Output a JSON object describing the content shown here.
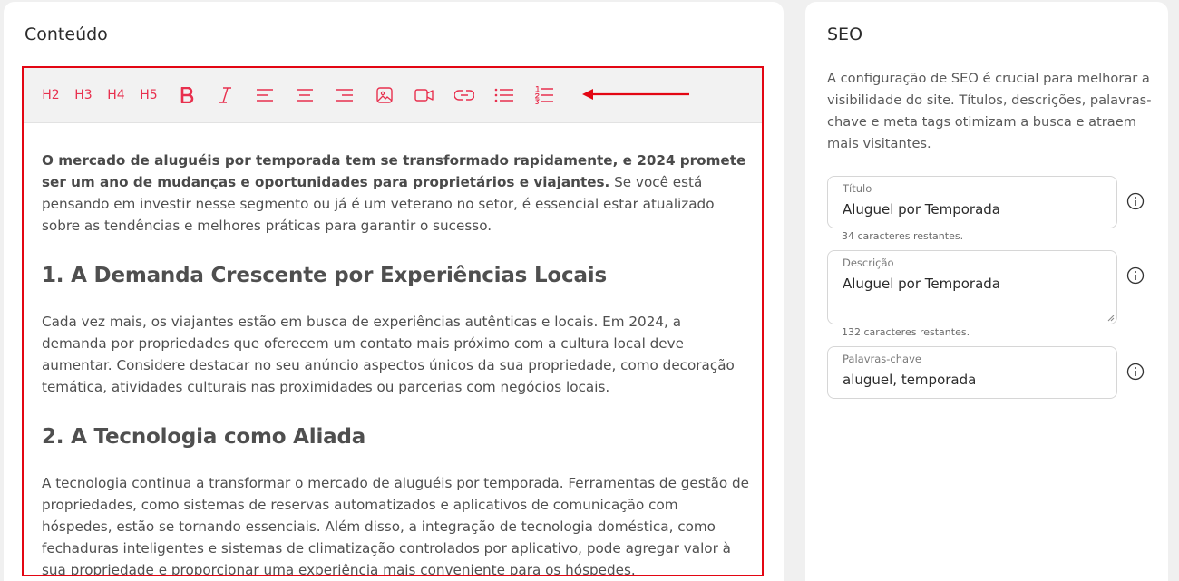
{
  "content_card": {
    "title": "Conteúdo",
    "toolbar": {
      "h2": "H2",
      "h3": "H3",
      "h4": "H4",
      "h5": "H5",
      "accent_color": "#e8304e",
      "highlight_color": "#e30613",
      "icons": [
        "bold-icon",
        "italic-icon",
        "align-left-icon",
        "align-center-icon",
        "align-right-icon",
        "image-icon",
        "video-icon",
        "link-icon",
        "bullet-list-icon",
        "numbered-list-icon"
      ]
    },
    "body": {
      "intro_bold": "O mercado de aluguéis por temporada tem se transformado rapidamente, e 2024 promete ser um ano de mudanças e oportunidades para proprietários e viajantes.",
      "intro_rest": " Se você está pensando em investir nesse segmento ou já é um veterano no setor, é essencial estar atualizado sobre as tendências e melhores práticas para garantir o sucesso.",
      "heading1": "1. A Demanda Crescente por Experiências Locais",
      "para1": "Cada vez mais, os viajantes estão em busca de experiências autênticas e locais. Em 2024, a demanda por propriedades que oferecem um contato mais próximo com a cultura local deve aumentar. Considere destacar no seu anúncio aspectos únicos da sua propriedade, como decoração temática, atividades culturais nas proximidades ou parcerias com negócios locais.",
      "heading2": "2. A Tecnologia como Aliada",
      "para2": "A tecnologia continua a transformar o mercado de aluguéis por temporada. Ferramentas de gestão de propriedades, como sistemas de reservas automatizados e aplicativos de comunicação com hóspedes, estão se tornando essenciais. Além disso, a integração de tecnologia doméstica, como fechaduras inteligentes e sistemas de climatização controlados por aplicativo, pode agregar valor à sua propriedade e proporcionar uma experiência mais conveniente para os hóspedes."
    }
  },
  "seo_card": {
    "title": "SEO",
    "description": "A configuração de SEO é crucial para melhorar a visibilidade do site. Títulos, descrições, palavras-chave e meta tags otimizam a busca e atraem mais visitantes.",
    "fields": [
      {
        "label": "Título",
        "value": "Aluguel por Temporada",
        "helper": "34 caracteres restantes."
      },
      {
        "label": "Descrição",
        "value": "Aluguel por Temporada",
        "helper": "132 caracteres restantes."
      },
      {
        "label": "Palavras-chave",
        "value": "aluguel, temporada"
      }
    ]
  }
}
